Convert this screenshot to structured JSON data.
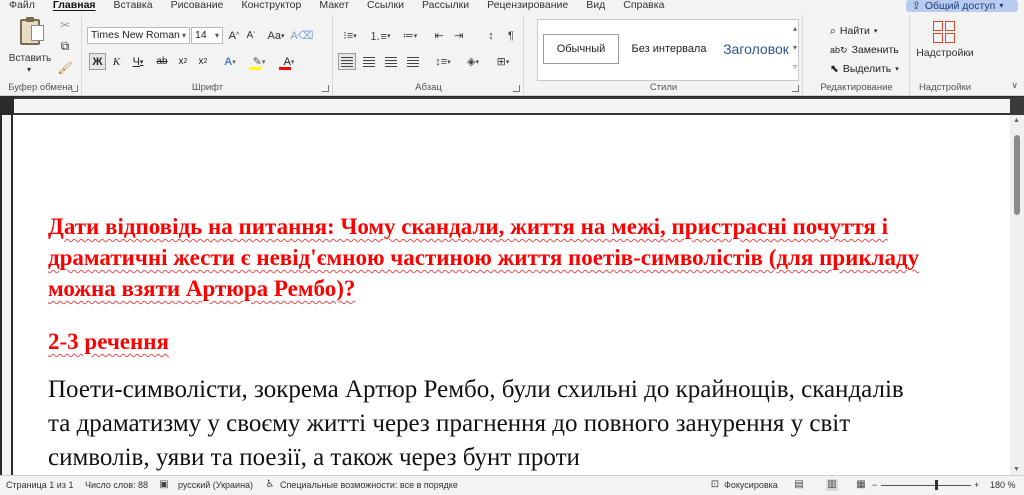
{
  "menu": {
    "tabs": [
      "Файл",
      "Главная",
      "Вставка",
      "Рисование",
      "Конструктор",
      "Макет",
      "Ссылки",
      "Рассылки",
      "Рецензирование",
      "Вид",
      "Справка"
    ],
    "active_tab": "Главная",
    "share_label": "Общий доступ"
  },
  "ribbon": {
    "clipboard": {
      "paste_label": "Вставить",
      "group_label": "Буфер обмена"
    },
    "font": {
      "font_name": "Times New Roman",
      "font_size": "14",
      "group_label": "Шрифт",
      "bold": "Ж",
      "italic": "К",
      "underline": "Ч",
      "change_case": "Aa",
      "highlight_color": "#ffff00",
      "font_color": "#ff0000"
    },
    "paragraph": {
      "group_label": "Абзац"
    },
    "styles": {
      "items": [
        "Обычный",
        "Без интервала",
        "Заголовок"
      ],
      "group_label": "Стили"
    },
    "editing": {
      "find": "Найти",
      "replace": "Заменить",
      "select": "Выделить",
      "group_label": "Редактирование"
    },
    "addins": {
      "button_label": "Надстройки",
      "group_label": "Надстройки"
    }
  },
  "document": {
    "question": "Дати відповідь на питання: Чому скандали, життя на межі, пристрасні почуття і драматичні жести є невід'ємною частиною життя поетів-символістів (для прикладу можна взяти Артюра Рембо)?",
    "sentence_count": "2-3 речення",
    "answer": "Поети-символісти, зокрема Артюр Рембо, були схильні до крайнощів, скандалів та драматизму у своєму житті через прагнення до повного занурення у світ символів, уяви та поезії, а також через бунт проти"
  },
  "status": {
    "page": "Страница 1 из 1",
    "words": "Число слов: 88",
    "language": "русский (Украина)",
    "accessibility": "Специальные возможности: все в порядке",
    "focus": "Фокусировка",
    "zoom": "180 %"
  }
}
